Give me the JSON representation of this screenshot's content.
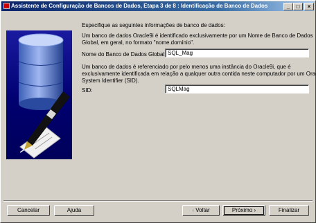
{
  "window": {
    "title": "Assistente de Configuração de Bancos de Dados, Etapa 3 de 8 : Identificação de Banco de Dados",
    "controls": {
      "minimize": "_",
      "maximize": "□",
      "close": "×"
    }
  },
  "main": {
    "instruction": "Especifique as seguintes informações de banco de dados:",
    "desc1_line1": "Um banco de dados Oracle9i é identificado exclusivamente por um Nome de Banco de Dados",
    "desc1_line2": "Global, em geral, no formato \"nome.domínio\".",
    "global_name_label": "Nome do Banco de Dados Global:",
    "global_name_value": "SQL_Mag",
    "desc2_line1": "Um banco de dados é referenciado por pelo menos uma instância do Oracle9i, que é",
    "desc2_line2": "exclusivamente identificada em relação a qualquer outra contida neste computador por um Oracle",
    "desc2_line3": "System Identifier (SID).",
    "sid_label": "SID:",
    "sid_value": "SQLMag"
  },
  "buttons": {
    "cancel": "Cancelar",
    "help": "Ajuda",
    "back": "Voltar",
    "next": "Próximo",
    "finish": "Finalizar"
  },
  "icons": {
    "side_image": "database-pen-icon",
    "back_arrow": "chevron-left-icon",
    "next_arrow": "chevron-right-icon"
  }
}
